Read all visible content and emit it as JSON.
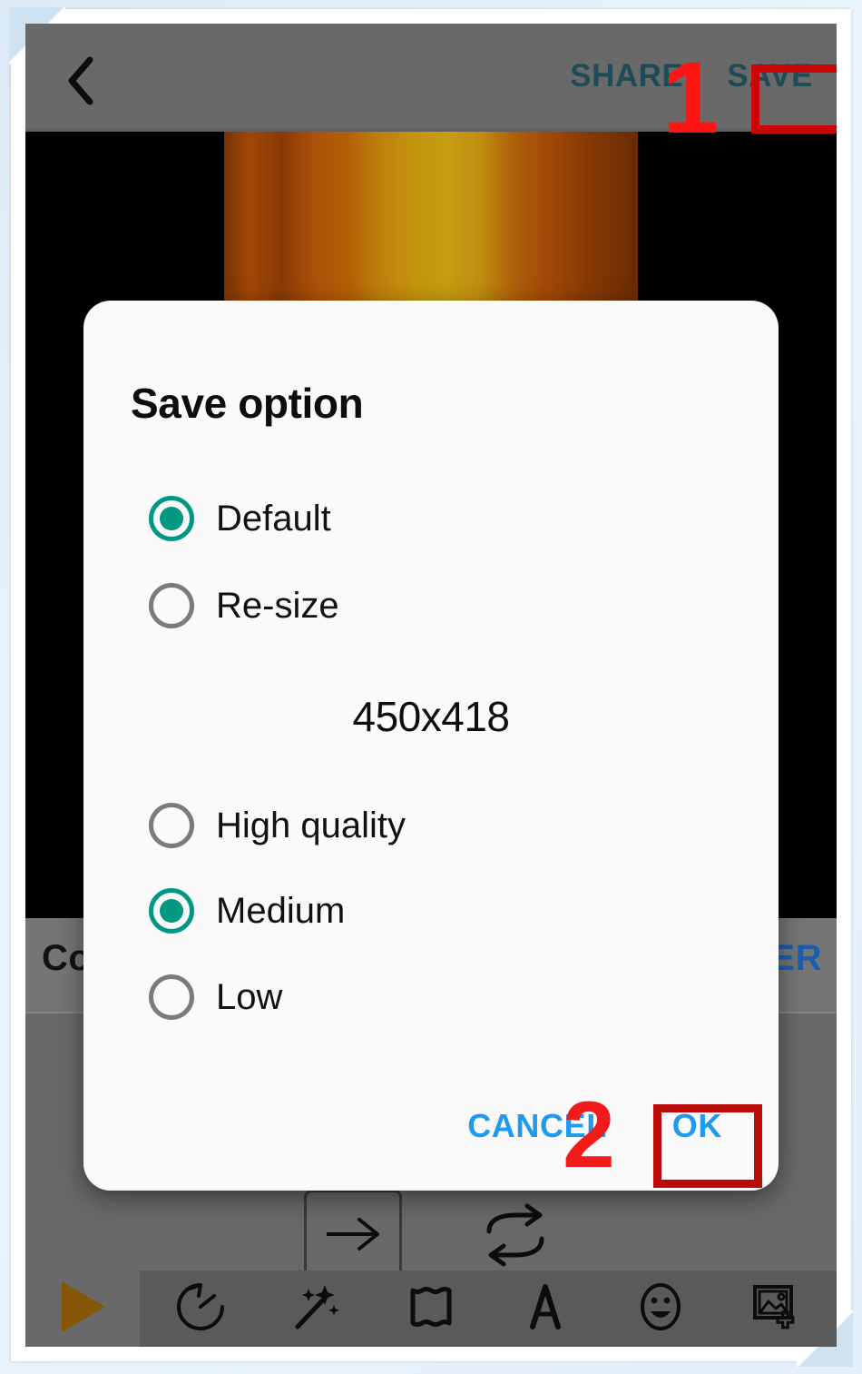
{
  "appbar": {
    "back_icon": "chevron-left-icon",
    "share_label": "SHARE",
    "save_label": "SAVE",
    "action_text_color": "#1f505b",
    "background_color": "#6e6e6e"
  },
  "background_strip": {
    "left_label": "Co",
    "right_label": "ER"
  },
  "dialog": {
    "title": "Save option",
    "size_value": "450x418",
    "accent_color": "#009783",
    "button_color": "#1e9bf0",
    "mode_options": [
      {
        "label": "Default",
        "checked": true
      },
      {
        "label": "Re-size",
        "checked": false
      }
    ],
    "quality_options": [
      {
        "label": "High quality",
        "checked": false
      },
      {
        "label": "Medium",
        "checked": true
      },
      {
        "label": "Low",
        "checked": false
      }
    ],
    "cancel_label": "CANCEL",
    "ok_label": "OK"
  },
  "workspace": {
    "next_icon": "arrow-right-icon",
    "loop_icon": "loop-repeat-icon",
    "play_icon": "play-triangle-icon"
  },
  "toolbar": {
    "items": [
      {
        "icon": "history-clock-icon"
      },
      {
        "icon": "magic-wand-icon"
      },
      {
        "icon": "frame-border-icon"
      },
      {
        "icon": "text-letter-a-icon"
      },
      {
        "icon": "smiley-face-icon"
      },
      {
        "icon": "add-image-icon"
      }
    ]
  },
  "annotations": {
    "marker_one": "1",
    "marker_two": "2",
    "highlight_color": "#cc0000"
  }
}
